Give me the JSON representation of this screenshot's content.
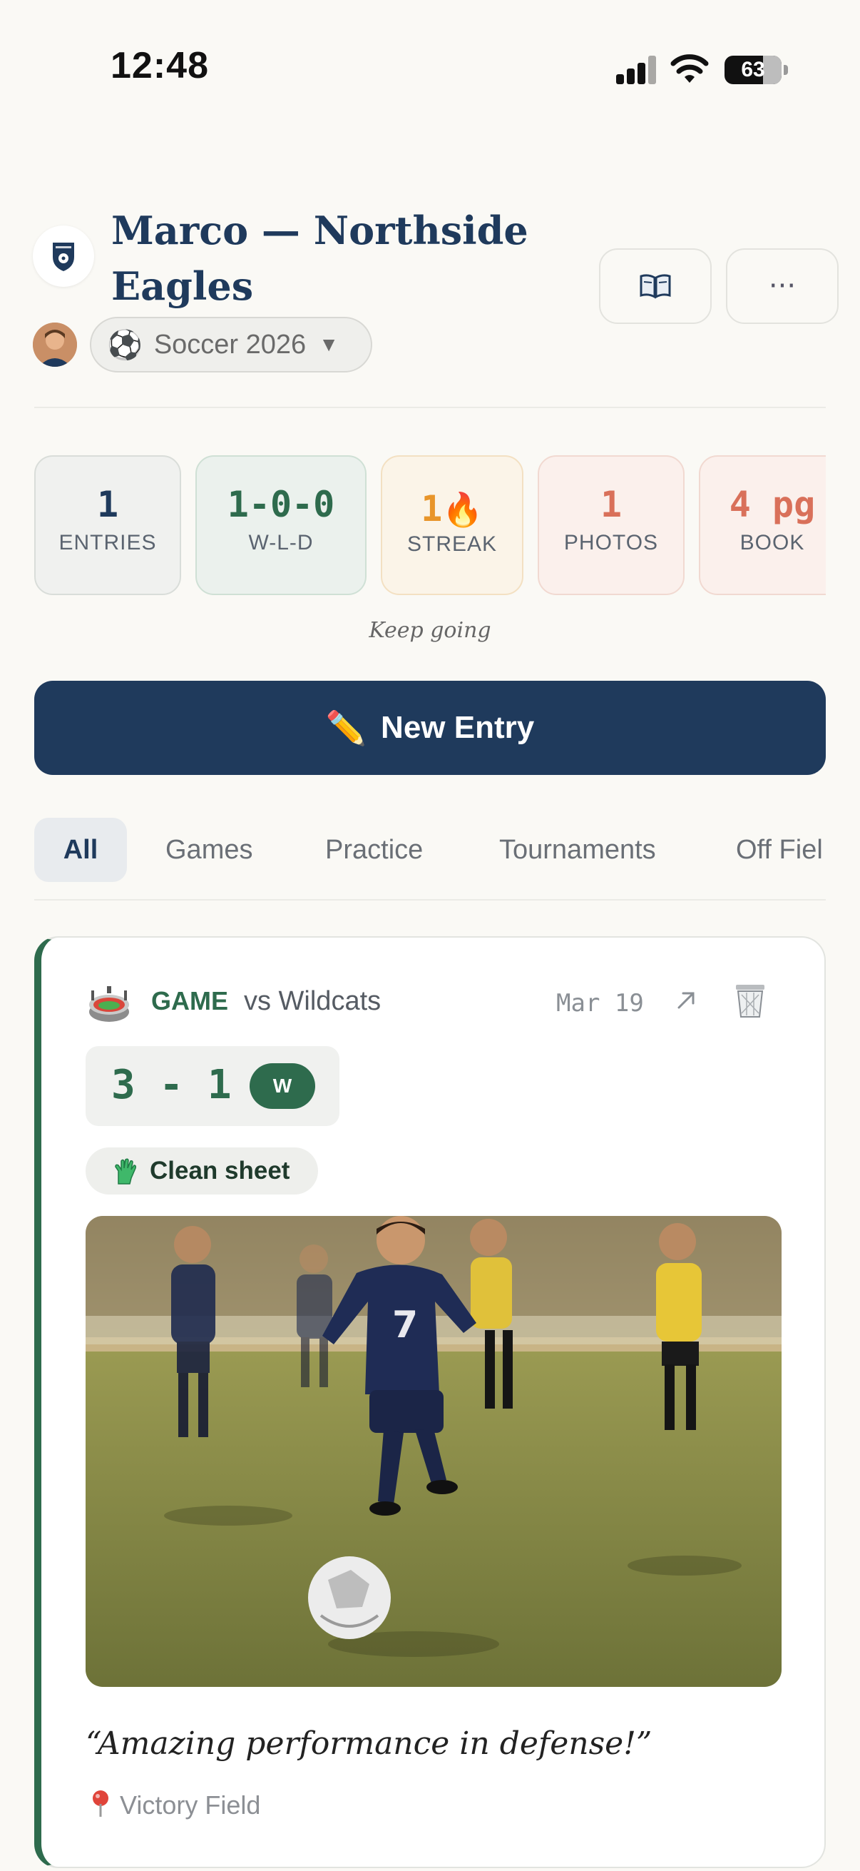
{
  "status_bar": {
    "time": "12:48",
    "battery": "63"
  },
  "header": {
    "title": "Marco — Northside Eagles",
    "book_icon": "book-icon",
    "more_icon": "more-icon",
    "more_label": "···",
    "season_label": "Soccer 2026"
  },
  "stats": [
    {
      "value": "1",
      "label": "ENTRIES",
      "color": "#1f3a5c"
    },
    {
      "value": "1-0-0",
      "label": "W-L-D",
      "color": "#2e6b4d"
    },
    {
      "value": "1",
      "label": "STREAK",
      "color": "#e8952a"
    },
    {
      "value": "1",
      "label": "PHOTOS",
      "color": "#d9705a"
    },
    {
      "value": "4 pg",
      "label": "BOOK",
      "color": "#d9705a"
    }
  ],
  "streak_caption": "Keep going",
  "new_entry_label": "New Entry",
  "filters": [
    "All",
    "Games",
    "Practice",
    "Tournaments",
    "Off Fiel"
  ],
  "entry": {
    "type": "GAME",
    "opponent": "vs Wildcats",
    "date": "Mar 19",
    "score": "3 - 1",
    "result": "W",
    "tag": "Clean sheet",
    "quote": "“Amazing performance in defense!”",
    "location": "Victory Field",
    "accent": "#2e6b4d"
  }
}
